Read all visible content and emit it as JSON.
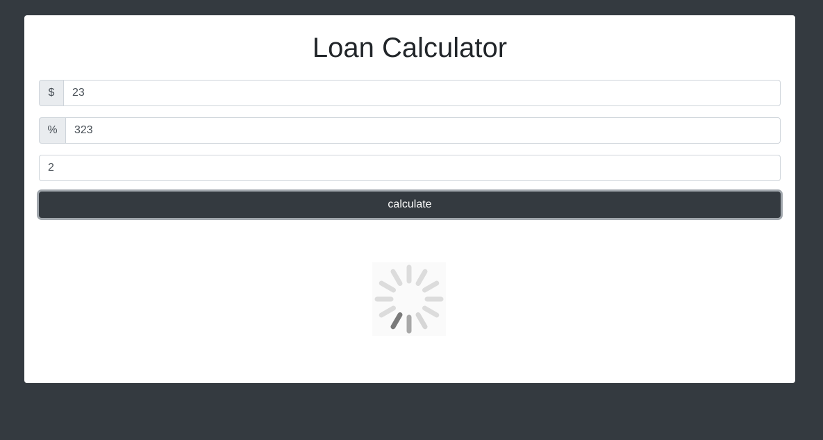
{
  "page": {
    "title": "Loan Calculator",
    "background_color": "#343a40",
    "card_color": "#ffffff"
  },
  "form": {
    "amount": {
      "addon": "$",
      "value": "23"
    },
    "interest": {
      "addon": "%",
      "value": "323"
    },
    "years": {
      "value": "2"
    },
    "submit_label": "calculate"
  },
  "loader": {
    "icon": "loading-spinner-icon",
    "state": "loading"
  }
}
